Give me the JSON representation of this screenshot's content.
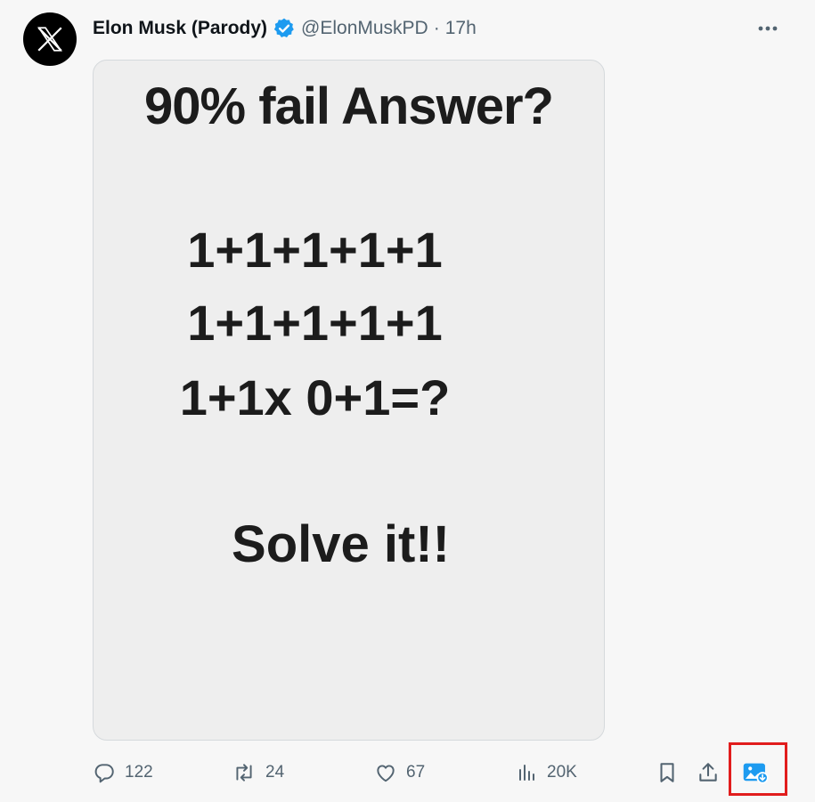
{
  "post": {
    "author_name": "Elon Musk (Parody)",
    "handle": "@ElonMuskPD",
    "separator": "·",
    "timestamp": "17h"
  },
  "media": {
    "title": "90% fail Answer?",
    "lines": [
      "1+1+1+1+1",
      "1+1+1+1+1",
      "1+1x 0+1=?"
    ],
    "footer": "Solve it!!"
  },
  "actions": {
    "replies": "122",
    "reposts": "24",
    "likes": "67",
    "views": "20K"
  },
  "colors": {
    "verified": "#1d9bf0",
    "image_button": "#1d9bf0",
    "highlight": "#e11d1d"
  },
  "icons": [
    "x-logo-icon",
    "verified-badge-icon",
    "more-icon",
    "reply-icon",
    "repost-icon",
    "like-icon",
    "views-icon",
    "bookmark-icon",
    "share-icon",
    "image-download-icon"
  ]
}
